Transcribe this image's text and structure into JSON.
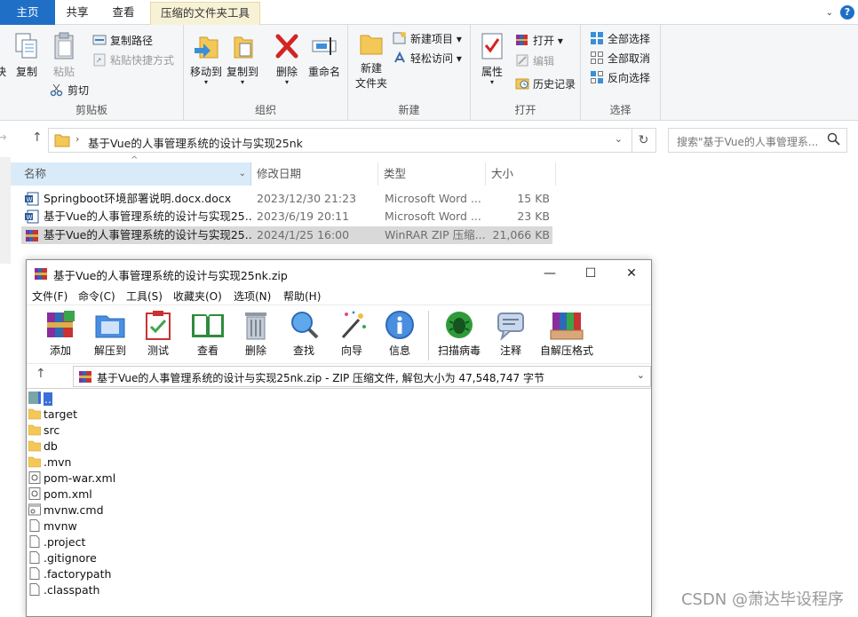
{
  "ribbon": {
    "tabs": [
      "主页",
      "共享",
      "查看",
      "压缩的文件夹工具"
    ],
    "groups": {
      "clipboard": {
        "label": "剪贴板",
        "partial_label": "快",
        "copy": "复制",
        "paste": "粘贴",
        "copy_path": "复制路径",
        "paste_shortcut": "粘贴快捷方式",
        "cut": "剪切"
      },
      "organize": {
        "label": "组织",
        "move_to": "移动到",
        "copy_to": "复制到",
        "delete": "删除",
        "rename": "重命名"
      },
      "new": {
        "label": "新建",
        "new_item": "新建项目",
        "easy_access": "轻松访问",
        "new_folder_line1": "新建",
        "new_folder_line2": "文件夹"
      },
      "open": {
        "label": "打开",
        "properties": "属性",
        "open": "打开",
        "edit": "编辑",
        "history": "历史记录"
      },
      "select": {
        "label": "选择",
        "select_all": "全部选择",
        "select_none": "全部取消",
        "invert": "反向选择"
      }
    }
  },
  "address": {
    "path": "基于Vue的人事管理系统的设计与实现25nk",
    "search_placeholder": "搜索\"基于Vue的人事管理系..."
  },
  "explorer": {
    "columns": [
      "名称",
      "修改日期",
      "类型",
      "大小"
    ],
    "files": [
      {
        "icon": "word-doc-icon",
        "name": "Springboot环境部署说明.docx.docx",
        "date": "2023/12/30 21:23",
        "type": "Microsoft Word ...",
        "size": "15 KB"
      },
      {
        "icon": "word-doc-icon",
        "name": "基于Vue的人事管理系统的设计与实现25...",
        "date": "2023/6/19 20:11",
        "type": "Microsoft Word ...",
        "size": "23 KB"
      },
      {
        "icon": "winrar-archive-icon",
        "name": "基于Vue的人事管理系统的设计与实现25...",
        "date": "2024/1/25 16:00",
        "type": "WinRAR ZIP 压缩...",
        "size": "21,066 KB",
        "selected": true
      }
    ]
  },
  "winrar": {
    "title": "基于Vue的人事管理系统的设计与实现25nk.zip",
    "menu": [
      "文件(F)",
      "命令(C)",
      "工具(S)",
      "收藏夹(O)",
      "选项(N)",
      "帮助(H)"
    ],
    "toolbar": [
      "添加",
      "解压到",
      "测试",
      "查看",
      "删除",
      "查找",
      "向导",
      "信息",
      "扫描病毒",
      "注释",
      "自解压格式"
    ],
    "path_text": "基于Vue的人事管理系统的设计与实现25nk.zip - ZIP 压缩文件, 解包大小为 47,548,747 字节",
    "items": [
      {
        "name": "..",
        "icon": "parent-folder-icon"
      },
      {
        "name": "target",
        "icon": "folder-icon"
      },
      {
        "name": "src",
        "icon": "folder-icon"
      },
      {
        "name": "db",
        "icon": "folder-icon"
      },
      {
        "name": ".mvn",
        "icon": "folder-icon"
      },
      {
        "name": "pom-war.xml",
        "icon": "xml-file-icon"
      },
      {
        "name": "pom.xml",
        "icon": "xml-file-icon"
      },
      {
        "name": "mvnw.cmd",
        "icon": "cmd-file-icon"
      },
      {
        "name": "mvnw",
        "icon": "file-icon"
      },
      {
        "name": ".project",
        "icon": "file-icon"
      },
      {
        "name": ".gitignore",
        "icon": "file-icon"
      },
      {
        "name": ".factorypath",
        "icon": "file-icon"
      },
      {
        "name": ".classpath",
        "icon": "file-icon"
      }
    ]
  },
  "watermark": "CSDN @萧达毕设程序"
}
